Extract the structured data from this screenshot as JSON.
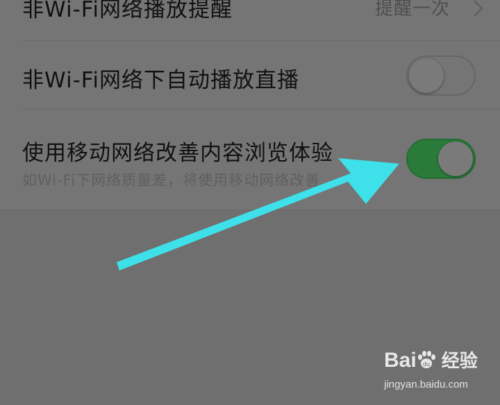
{
  "settings": {
    "rows": [
      {
        "title": "非Wi-Fi网络播放提醒",
        "value": "提醒一次"
      },
      {
        "title": "非Wi-Fi网络下自动播放直播",
        "toggle": "off"
      },
      {
        "title": "使用移动网络改善内容浏览体验",
        "subtitle": "如Wi-Fi下网络质量差，将使用移动网络改善",
        "toggle": "on"
      }
    ]
  },
  "annotation": {
    "arrow_color": "#3ee0ea"
  },
  "watermark": {
    "logo": "Bai 经验",
    "logo_left": "Bai",
    "logo_right": "经验",
    "url": "jingyan.baidu.com"
  },
  "colors": {
    "toggle_on": "#2a7a39",
    "background": "#6f6f6f"
  }
}
